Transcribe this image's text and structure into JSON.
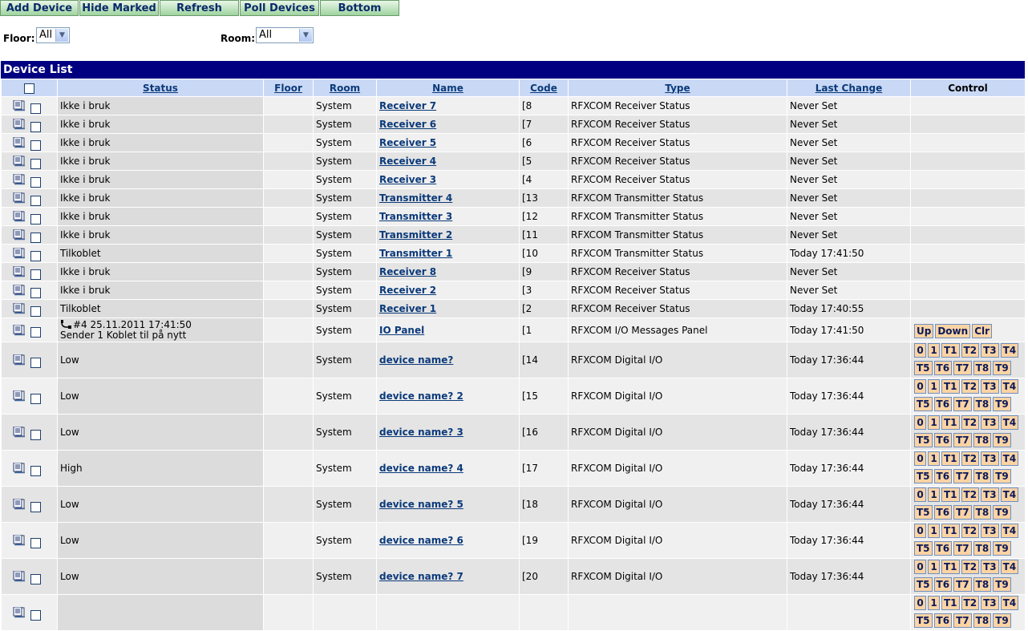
{
  "toolbar": [
    {
      "label": "Add Device",
      "width": 98
    },
    {
      "label": "Hide Marked",
      "width": 99
    },
    {
      "label": "Refresh",
      "width": 99
    },
    {
      "label": "Poll Devices",
      "width": 99
    },
    {
      "label": "Bottom",
      "width": 99
    }
  ],
  "filters": {
    "floor_label": "Floor:",
    "floor_value": "All",
    "room_label": "Room:",
    "room_value": "All"
  },
  "device_list": {
    "title": "Device List",
    "columns": [
      "Status",
      "Floor",
      "Room",
      "Name",
      "Code",
      "Type",
      "Last Change",
      "Control"
    ],
    "rows": [
      {
        "status": "Ikke i bruk",
        "floor": "",
        "room": "System",
        "name": "Receiver 7",
        "code": "[8",
        "type": "RFXCOM Receiver Status",
        "last_change": "Never Set",
        "control": "none"
      },
      {
        "status": "Ikke i bruk",
        "floor": "",
        "room": "System",
        "name": "Receiver 6",
        "code": "[7",
        "type": "RFXCOM Receiver Status",
        "last_change": "Never Set",
        "control": "none"
      },
      {
        "status": "Ikke i bruk",
        "floor": "",
        "room": "System",
        "name": "Receiver 5",
        "code": "[6",
        "type": "RFXCOM Receiver Status",
        "last_change": "Never Set",
        "control": "none"
      },
      {
        "status": "Ikke i bruk",
        "floor": "",
        "room": "System",
        "name": "Receiver 4",
        "code": "[5",
        "type": "RFXCOM Receiver Status",
        "last_change": "Never Set",
        "control": "none"
      },
      {
        "status": "Ikke i bruk",
        "floor": "",
        "room": "System",
        "name": "Receiver 3",
        "code": "[4",
        "type": "RFXCOM Receiver Status",
        "last_change": "Never Set",
        "control": "none"
      },
      {
        "status": "Ikke i bruk",
        "floor": "",
        "room": "System",
        "name": "Transmitter 4",
        "code": "[13",
        "type": "RFXCOM Transmitter Status",
        "last_change": "Never Set",
        "control": "none"
      },
      {
        "status": "Ikke i bruk",
        "floor": "",
        "room": "System",
        "name": "Transmitter 3",
        "code": "[12",
        "type": "RFXCOM Transmitter Status",
        "last_change": "Never Set",
        "control": "none"
      },
      {
        "status": "Ikke i bruk",
        "floor": "",
        "room": "System",
        "name": "Transmitter 2",
        "code": "[11",
        "type": "RFXCOM Transmitter Status",
        "last_change": "Never Set",
        "control": "none"
      },
      {
        "status": "Tilkoblet",
        "floor": "",
        "room": "System",
        "name": "Transmitter 1",
        "code": "[10",
        "type": "RFXCOM Transmitter Status",
        "last_change": "Today 17:41:50",
        "control": "none"
      },
      {
        "status": "Ikke i bruk",
        "floor": "",
        "room": "System",
        "name": "Receiver 8",
        "code": "[9",
        "type": "RFXCOM Receiver Status",
        "last_change": "Never Set",
        "control": "none"
      },
      {
        "status": "Ikke i bruk",
        "floor": "",
        "room": "System",
        "name": "Receiver 2",
        "code": "[3",
        "type": "RFXCOM Receiver Status",
        "last_change": "Never Set",
        "control": "none"
      },
      {
        "status": "Tilkoblet",
        "floor": "",
        "room": "System",
        "name": "Receiver 1",
        "code": "[2",
        "type": "RFXCOM Receiver Status",
        "last_change": "Today 17:40:55",
        "control": "none"
      },
      {
        "status": "#4 25.11.2011 17:41:50",
        "status2": "Sender 1 Koblet til på nytt",
        "status_icon": "plug-icon",
        "floor": "",
        "room": "System",
        "name": "IO Panel",
        "code": "[1",
        "type": "RFXCOM I/O Messages Panel",
        "last_change": "Today 17:41:50",
        "control": "panel"
      },
      {
        "status": "Low",
        "floor": "",
        "room": "System",
        "name": "device name?",
        "code": "[14",
        "type": "RFXCOM Digital I/O",
        "last_change": "Today 17:36:44",
        "control": "digital"
      },
      {
        "status": "Low",
        "floor": "",
        "room": "System",
        "name": "device name?  2",
        "code": "[15",
        "type": "RFXCOM Digital I/O",
        "last_change": "Today 17:36:44",
        "control": "digital"
      },
      {
        "status": "Low",
        "floor": "",
        "room": "System",
        "name": "device name?  3",
        "code": "[16",
        "type": "RFXCOM Digital I/O",
        "last_change": "Today 17:36:44",
        "control": "digital"
      },
      {
        "status": "High",
        "floor": "",
        "room": "System",
        "name": "device name?  4",
        "code": "[17",
        "type": "RFXCOM Digital I/O",
        "last_change": "Today 17:36:44",
        "control": "digital"
      },
      {
        "status": "Low",
        "floor": "",
        "room": "System",
        "name": "device name?  5",
        "code": "[18",
        "type": "RFXCOM Digital I/O",
        "last_change": "Today 17:36:44",
        "control": "digital"
      },
      {
        "status": "Low",
        "floor": "",
        "room": "System",
        "name": "device name?  6",
        "code": "[19",
        "type": "RFXCOM Digital I/O",
        "last_change": "Today 17:36:44",
        "control": "digital"
      },
      {
        "status": "Low",
        "floor": "",
        "room": "System",
        "name": "device name?  7",
        "code": "[20",
        "type": "RFXCOM Digital I/O",
        "last_change": "Today 17:36:44",
        "control": "digital"
      },
      {
        "status": "",
        "floor": "",
        "room": "",
        "name": "",
        "code": "",
        "type": "",
        "last_change": "",
        "control": "digital"
      }
    ]
  },
  "controls": {
    "panel_buttons": [
      "Up",
      "Down",
      "Clr"
    ],
    "digital_row1": [
      "0",
      "1",
      "T1",
      "T2",
      "T3",
      "T4"
    ],
    "digital_row2": [
      "T5",
      "T6",
      "T7",
      "T8",
      "T9"
    ]
  },
  "icons": {
    "row_icon": "log-icon",
    "dropdown_icon": "chevron-down-icon"
  },
  "colors": {
    "title_bar": "#000080",
    "header_bg": "#c9d8f5",
    "toolbar_green": "#9fd39f",
    "control_button": "#fcd3a3"
  }
}
